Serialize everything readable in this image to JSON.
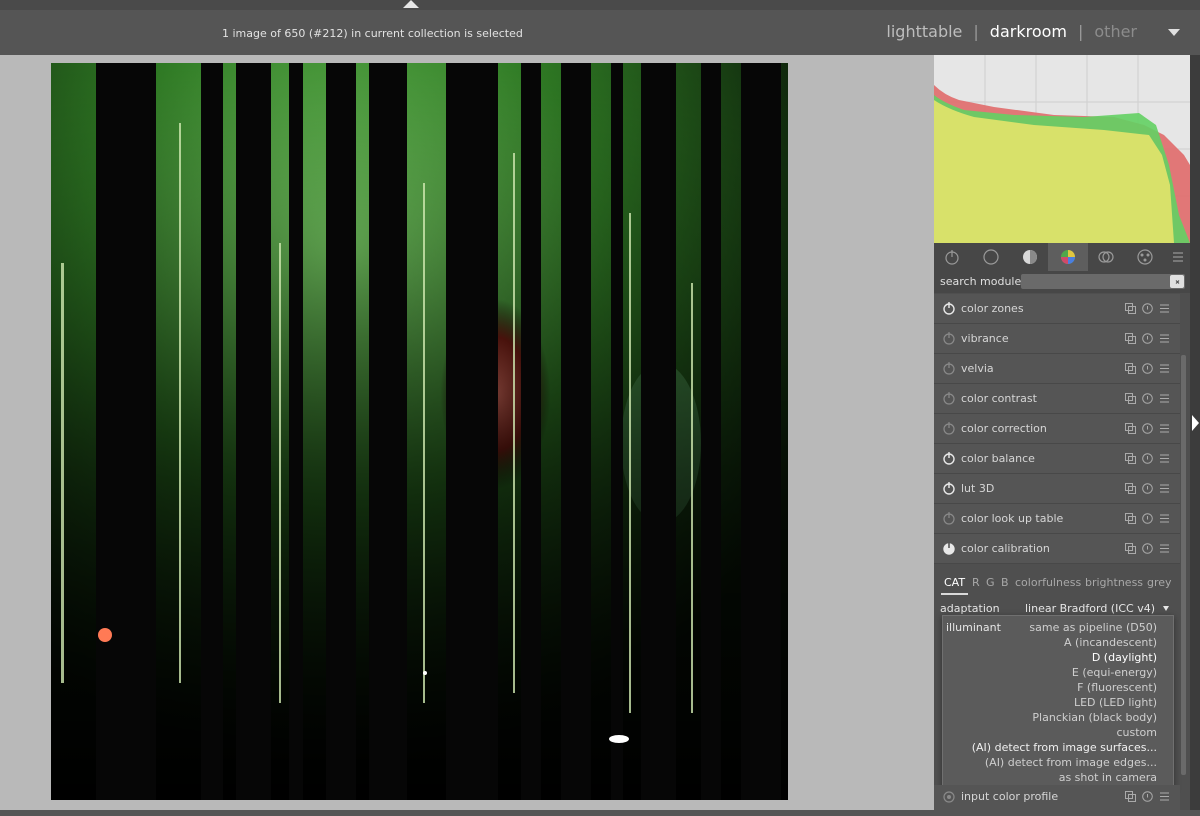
{
  "header": {
    "status_text": "1 image of 650 (#212) in current collection is selected",
    "views": [
      "lighttable",
      "darkroom",
      "other"
    ],
    "separator": "|",
    "active_view": "darkroom"
  },
  "right_panel": {
    "search": {
      "label": "search module"
    },
    "module_groups": [
      "power-icon",
      "circle-icon",
      "tone-icon",
      "color-icon",
      "correct-icon",
      "effects-icon",
      "menu-icon"
    ],
    "modules": [
      {
        "name": "color zones",
        "enabled": true
      },
      {
        "name": "vibrance",
        "enabled": false
      },
      {
        "name": "velvia",
        "enabled": false
      },
      {
        "name": "color contrast",
        "enabled": false
      },
      {
        "name": "color correction",
        "enabled": false
      },
      {
        "name": "color balance",
        "enabled": true
      },
      {
        "name": "lut 3D",
        "enabled": true
      },
      {
        "name": "color look up table",
        "enabled": false
      },
      {
        "name": "color calibration",
        "enabled": true
      }
    ],
    "color_calibration": {
      "tabs": [
        "CAT",
        "R",
        "G",
        "B",
        "colorfulness",
        "brightness",
        "grey"
      ],
      "active_tab": "CAT",
      "adaptation": {
        "label": "adaptation",
        "value": "linear Bradford (ICC v4)"
      },
      "illuminant": {
        "label": "illuminant",
        "options": [
          "same as pipeline (D50)",
          "A (incandescent)",
          "D (daylight)",
          "E (equi-energy)",
          "F (fluorescent)",
          "LED (LED light)",
          "Planckian (black body)",
          "custom",
          "(AI) detect from image surfaces...",
          "(AI) detect from image edges...",
          "as shot in camera"
        ],
        "selected": "D (daylight)",
        "highlighted": "(AI) detect from image surfaces..."
      }
    },
    "bottom_module": {
      "name": "input color profile"
    }
  },
  "colors": {
    "panel_bg": "#4f4f4f",
    "header_bg": "#555555",
    "canvas_bg": "#b9b9b9",
    "histogram_red": "#e06a6a",
    "histogram_green": "#63d063",
    "histogram_yellow": "#e3e36a"
  }
}
